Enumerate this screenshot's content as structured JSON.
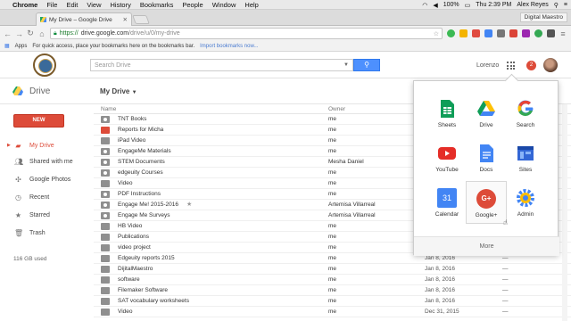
{
  "os_menu": {
    "app": "Chrome",
    "items": [
      "File",
      "Edit",
      "View",
      "History",
      "Bookmarks",
      "People",
      "Window",
      "Help"
    ],
    "battery": "100%",
    "clock": "Thu 2:39 PM",
    "user": "Alex Reyes"
  },
  "browser": {
    "tab_title": "My Drive – Google Drive",
    "profile": "Digital Maestro",
    "url_secure": "https://",
    "url_host": "drive.google.com",
    "url_path": "/drive/u/0/my-drive",
    "bookmarks_apps": "Apps",
    "bookmarks_hint": "For quick access, place your bookmarks here on the bookmarks bar.",
    "bookmarks_import": "Import bookmarks now..."
  },
  "header": {
    "search_placeholder": "Search Drive",
    "user_name": "Lorenzo",
    "notifications": "2"
  },
  "subheader": {
    "drive_title": "Drive",
    "location": "My Drive"
  },
  "sidebar": {
    "new_label": "NEW",
    "items": [
      {
        "label": "My Drive",
        "icon": "drive-folder-icon"
      },
      {
        "label": "Shared with me",
        "icon": "people-icon"
      },
      {
        "label": "Google Photos",
        "icon": "pinwheel-icon"
      },
      {
        "label": "Recent",
        "icon": "clock-icon"
      },
      {
        "label": "Starred",
        "icon": "star-icon"
      },
      {
        "label": "Trash",
        "icon": "trash-icon"
      }
    ],
    "storage": "116 GB used"
  },
  "list": {
    "col_name": "Name",
    "col_owner": "Owner",
    "rows": [
      {
        "name": "TNT Books",
        "owner": "me",
        "modified": "",
        "shared": true,
        "color": "#8f8f8f"
      },
      {
        "name": "Reports for Micha",
        "owner": "me",
        "modified": "",
        "shared": false,
        "color": "#dd4b39"
      },
      {
        "name": "iPad Video",
        "owner": "me",
        "modified": "",
        "shared": false,
        "color": "#8f8f8f"
      },
      {
        "name": "EngageMe Materials",
        "owner": "me",
        "modified": "",
        "shared": true,
        "color": "#8f8f8f"
      },
      {
        "name": "STEM Documents",
        "owner": "Mesha Daniel",
        "modified": "",
        "shared": true,
        "color": "#8f8f8f"
      },
      {
        "name": "edgeuity Courses",
        "owner": "me",
        "modified": "",
        "shared": true,
        "color": "#8f8f8f"
      },
      {
        "name": "Video",
        "owner": "me",
        "modified": "",
        "shared": false,
        "color": "#8f8f8f"
      },
      {
        "name": "PDF Instructions",
        "owner": "me",
        "modified": "",
        "shared": true,
        "color": "#8f8f8f"
      },
      {
        "name": "Engage Me! 2015-2016",
        "owner": "Artemisa Villarreal",
        "modified": "",
        "shared": true,
        "color": "#8f8f8f",
        "starred": "★"
      },
      {
        "name": "Engage Me Surveys",
        "owner": "Artemisa Villarreal",
        "modified": "",
        "shared": true,
        "color": "#8f8f8f"
      },
      {
        "name": "HB Video",
        "owner": "me",
        "modified": "",
        "shared": false,
        "color": "#8f8f8f"
      },
      {
        "name": "Publications",
        "owner": "me",
        "modified": "",
        "shared": false,
        "color": "#8f8f8f"
      },
      {
        "name": "video project",
        "owner": "me",
        "modified": "",
        "shared": false,
        "color": "#8f8f8f"
      },
      {
        "name": "Edgeuity reports 2015",
        "owner": "me",
        "modified": "Jan 8, 2016",
        "shared": false,
        "color": "#8f8f8f"
      },
      {
        "name": "DijitalMaestro",
        "owner": "me",
        "modified": "Jan 8, 2016",
        "shared": false,
        "color": "#8f8f8f"
      },
      {
        "name": "software",
        "owner": "me",
        "modified": "Jan 8, 2016",
        "shared": false,
        "color": "#8f8f8f"
      },
      {
        "name": "Filemaker Software",
        "owner": "me",
        "modified": "Jan 8, 2016",
        "shared": false,
        "color": "#8f8f8f"
      },
      {
        "name": "SAT vocabulary worksheets",
        "owner": "me",
        "modified": "Jan 8, 2016",
        "shared": false,
        "color": "#8f8f8f"
      },
      {
        "name": "Video",
        "owner": "me",
        "modified": "Dec 31, 2015",
        "shared": false,
        "color": "#8f8f8f"
      }
    ],
    "dash": "—"
  },
  "apps_popup": {
    "apps": [
      {
        "label": "Sheets",
        "icon": "sheets-icon"
      },
      {
        "label": "Drive",
        "icon": "drive-icon"
      },
      {
        "label": "Search",
        "icon": "google-search-icon"
      },
      {
        "label": "YouTube",
        "icon": "youtube-icon"
      },
      {
        "label": "Docs",
        "icon": "docs-icon"
      },
      {
        "label": "Sites",
        "icon": "sites-icon"
      },
      {
        "label": "Calendar",
        "icon": "calendar-icon",
        "glyph": "31"
      },
      {
        "label": "Google+",
        "icon": "google-plus-icon",
        "glyph": "G+"
      },
      {
        "label": "Admin",
        "icon": "admin-gear-icon"
      }
    ],
    "more": "More"
  }
}
